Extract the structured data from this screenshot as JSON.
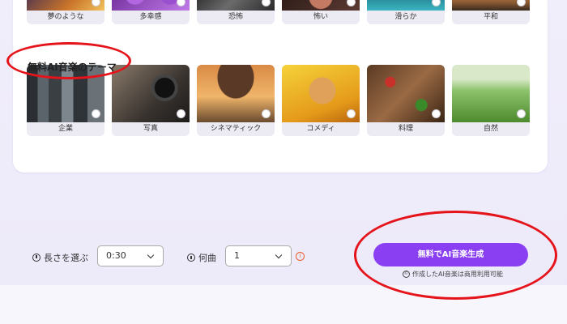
{
  "mood_tiles": [
    {
      "label": "夢のような"
    },
    {
      "label": "多幸感"
    },
    {
      "label": "恐怖"
    },
    {
      "label": "怖い"
    },
    {
      "label": "滑らか"
    },
    {
      "label": "平和"
    }
  ],
  "theme_section": {
    "title": "無料AI音楽のテーマ",
    "tiles": [
      {
        "label": "企業"
      },
      {
        "label": "写真"
      },
      {
        "label": "シネマティック"
      },
      {
        "label": "コメディ"
      },
      {
        "label": "料理"
      },
      {
        "label": "自然"
      }
    ]
  },
  "controls": {
    "length_label": "長さを選ぶ",
    "length_value": "0:30",
    "count_label": "何曲",
    "count_value": "1",
    "info_glyph": "i"
  },
  "generate": {
    "button_label": "無料でAI音楽生成",
    "note": "作成したAI音楽は商用利用可能",
    "note_icon": "©"
  },
  "colors": {
    "accent": "#8b3ff2",
    "highlight_circle": "#e5131a"
  }
}
